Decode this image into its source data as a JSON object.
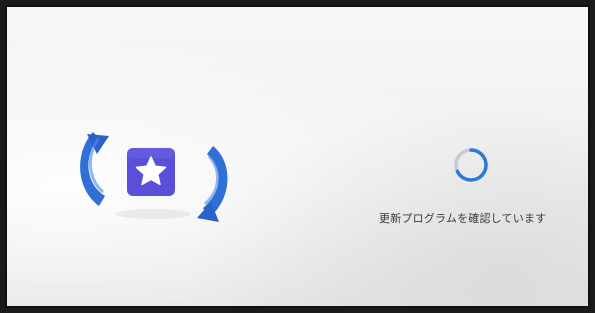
{
  "screen": {
    "status_text": "更新プログラムを確認しています",
    "illustration_icon": "update-refresh-star-icon",
    "spinner_icon": "progress-ring-icon"
  },
  "colors": {
    "arrow_blue": "#2f6fd6",
    "tile_purple": "#5a4fd8",
    "spinner_active": "#2e78d8",
    "spinner_track": "#c9cbd1",
    "text": "#3a3a3a"
  }
}
